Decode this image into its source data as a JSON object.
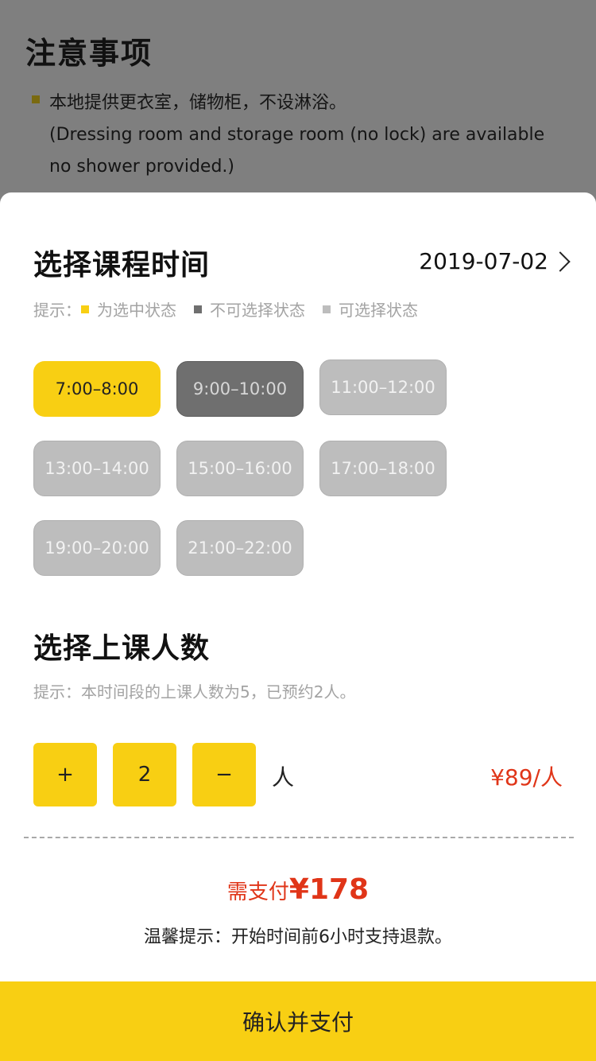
{
  "notice": {
    "title": "注意事项",
    "item_zh": "本地提供更衣室，储物柜，不设淋浴。",
    "item_en": "(Dressing room and storage room (no lock) are available no shower provided.)"
  },
  "time_section": {
    "title": "选择课程时间",
    "date": "2019-07-02",
    "hint_prefix": "提示：",
    "legend": [
      {
        "label": "为选中状态",
        "color": "#f8cf13"
      },
      {
        "label": "不可选择状态",
        "color": "#6f6f6f"
      },
      {
        "label": "可选择状态",
        "color": "#bdbdbd"
      }
    ],
    "slots": [
      {
        "label": "7:00–8:00",
        "state": "selected"
      },
      {
        "label": "9:00–10:00",
        "state": "disabled"
      },
      {
        "label": "11:00–12:00",
        "state": "available"
      },
      {
        "label": "13:00–14:00",
        "state": "available"
      },
      {
        "label": "15:00–16:00",
        "state": "available"
      },
      {
        "label": "17:00–18:00",
        "state": "available"
      },
      {
        "label": "19:00–20:00",
        "state": "available"
      },
      {
        "label": "21:00–22:00",
        "state": "available"
      }
    ]
  },
  "people_section": {
    "title": "选择上课人数",
    "hint": "提示：本时间段的上课人数为5，已预约2人。",
    "plus": "+",
    "count": "2",
    "minus": "−",
    "unit": "人",
    "price": "¥89/人"
  },
  "summary": {
    "total_label": "需支付",
    "total_amount": "¥178",
    "refund_tip": "温馨提示：开始时间前6小时支持退款。"
  },
  "footer": {
    "confirm_label": "确认并支付"
  },
  "colors": {
    "accent": "#f8cf13",
    "price": "#e03518",
    "disabled": "#6f6f6f",
    "available": "#bdbdbd"
  }
}
